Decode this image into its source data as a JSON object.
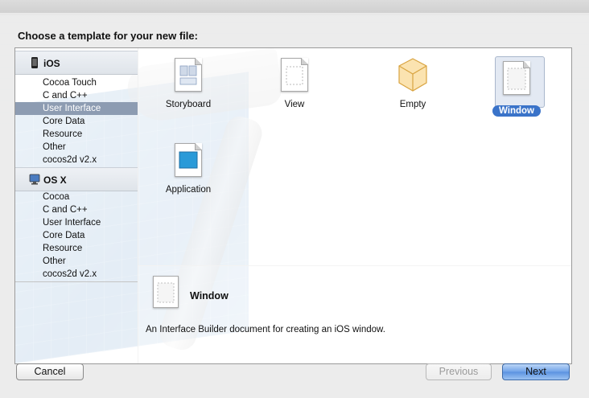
{
  "dialog": {
    "title": "Choose a template for your new file:"
  },
  "sidebar": {
    "sections": [
      {
        "name": "iOS",
        "icon": "iphone-icon",
        "items": [
          "Cocoa Touch",
          "C and C++",
          "User Interface",
          "Core Data",
          "Resource",
          "Other",
          "cocos2d v2.x"
        ],
        "selected_index": 2
      },
      {
        "name": "OS X",
        "icon": "mac-icon",
        "items": [
          "Cocoa",
          "C and C++",
          "User Interface",
          "Core Data",
          "Resource",
          "Other",
          "cocos2d v2.x"
        ],
        "selected_index": -1
      }
    ]
  },
  "templates": [
    {
      "label": "Storyboard",
      "icon": "storyboard-file-icon"
    },
    {
      "label": "View",
      "icon": "view-file-icon"
    },
    {
      "label": "Empty",
      "icon": "empty-cube-icon"
    },
    {
      "label": "Window",
      "icon": "window-file-icon",
      "selected": true
    },
    {
      "label": "Application",
      "icon": "application-file-icon"
    }
  ],
  "detail": {
    "name": "Window",
    "description": "An Interface Builder document for creating an iOS window."
  },
  "buttons": {
    "cancel": "Cancel",
    "previous": "Previous",
    "next": "Next"
  },
  "colors": {
    "selection": "#3a73c9",
    "sidebar_selection": "#8d9cb2",
    "primary_button": "#5a92e0"
  }
}
